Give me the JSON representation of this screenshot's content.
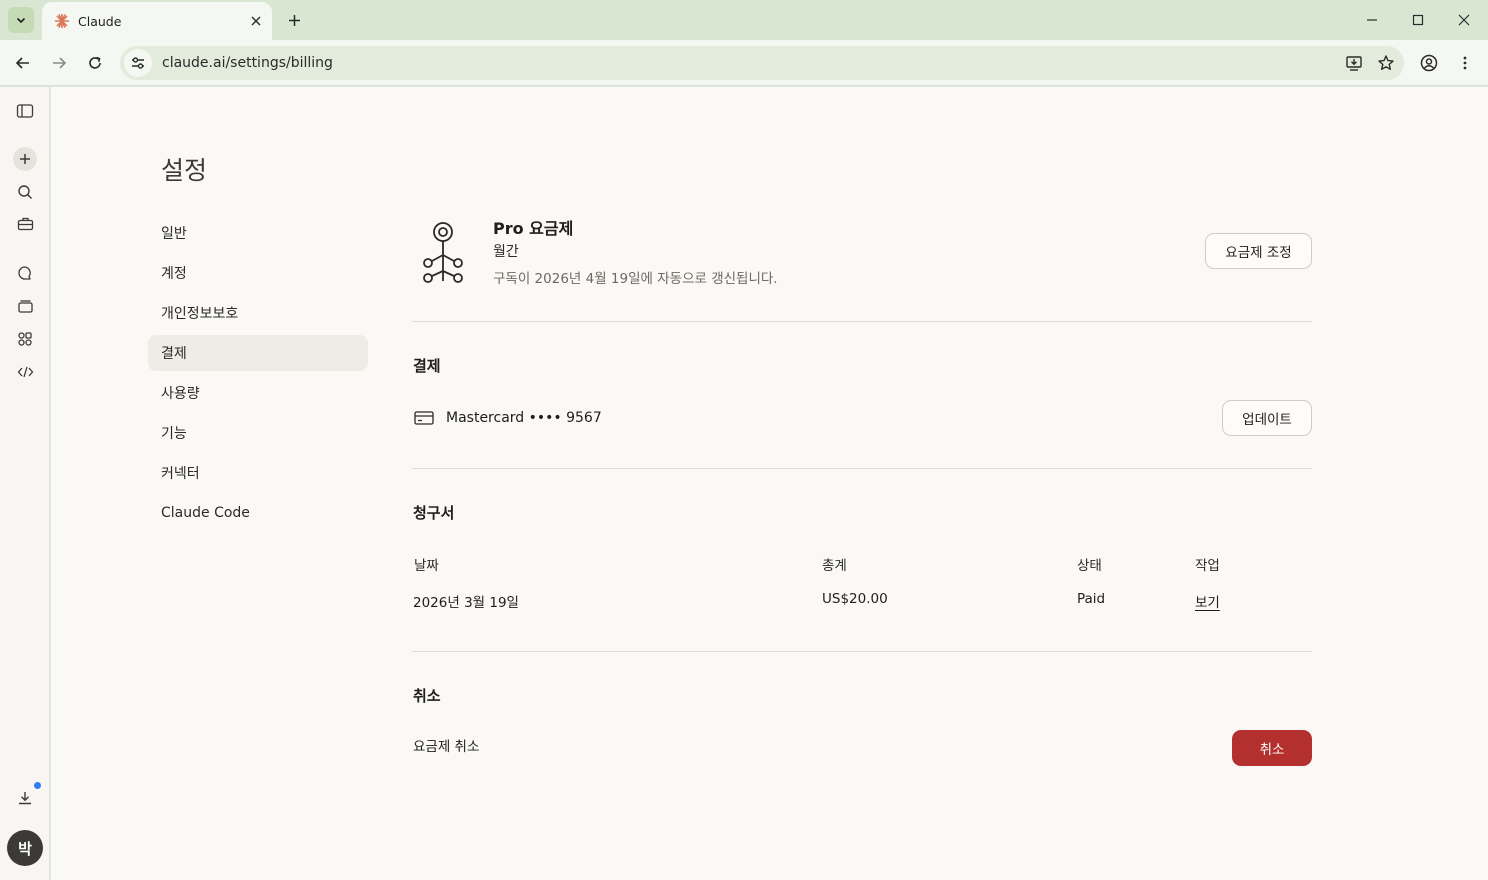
{
  "browser": {
    "tab_title": "Claude",
    "url": "claude.ai/settings/billing"
  },
  "rail": {
    "avatar_initial": "박"
  },
  "settings": {
    "title": "설정",
    "nav": [
      {
        "label": "일반"
      },
      {
        "label": "계정"
      },
      {
        "label": "개인정보보호"
      },
      {
        "label": "결제",
        "active": true
      },
      {
        "label": "사용량"
      },
      {
        "label": "기능"
      },
      {
        "label": "커넥터"
      },
      {
        "label": "Claude Code"
      }
    ]
  },
  "plan": {
    "name": "Pro 요금제",
    "period": "월간",
    "renewal": "구독이 2026년 4월 19일에 자동으로 갱신됩니다.",
    "adjust_button": "요금제 조정"
  },
  "payment": {
    "title": "결제",
    "card": "Mastercard •••• 9567",
    "update_button": "업데이트"
  },
  "invoices": {
    "title": "청구서",
    "columns": [
      "날짜",
      "총계",
      "상태",
      "작업"
    ],
    "rows": [
      {
        "date": "2026년 3월 19일",
        "total": "US$20.00",
        "status": "Paid",
        "action": "보기"
      }
    ]
  },
  "cancel": {
    "title": "취소",
    "label": "요금제 취소",
    "button": "취소"
  },
  "colors": {
    "danger": "#b3302e",
    "chrome": "#d9e6d1",
    "page_bg": "#faf9f5",
    "favicon": "#d97757"
  }
}
